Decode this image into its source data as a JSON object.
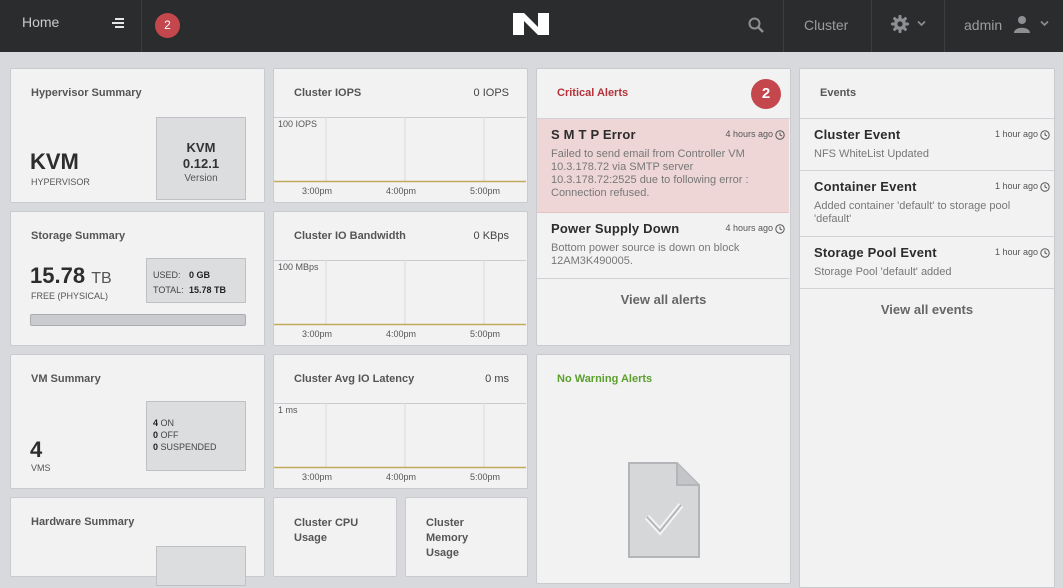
{
  "topbar": {
    "home_label": "Home",
    "alert_count": "2",
    "cluster_label": "Cluster",
    "user_label": "admin"
  },
  "colors": {
    "topbar_bg": "#2b2c2e",
    "badge_red": "#c4474d",
    "critical_bg": "#eed6d6",
    "no_warning_green": "#5b9f2d"
  },
  "hypervisor": {
    "title": "Hypervisor Summary",
    "name": "KVM",
    "sublabel": "HYPERVISOR",
    "box_name": "KVM",
    "box_version": "0.12.1",
    "box_label": "Version"
  },
  "storage": {
    "title": "Storage Summary",
    "value": "15.78",
    "unit": "TB",
    "sublabel": "FREE (PHYSICAL)",
    "used_label": "USED:",
    "used_value": "0 GB",
    "total_label": "TOTAL:",
    "total_value": "15.78 TB",
    "used_fraction": 0
  },
  "vm": {
    "title": "VM Summary",
    "count": "4",
    "sublabel": "VMS",
    "on_count": "4",
    "on_label": "ON",
    "off_count": "0",
    "off_label": "OFF",
    "suspended_count": "0",
    "suspended_label": "SUSPENDED"
  },
  "hardware": {
    "title": "Hardware Summary"
  },
  "iops": {
    "title": "Cluster IOPS",
    "value": "0 IOPS",
    "ymax": "100 IOPS",
    "x_ticks": [
      "3:00pm",
      "4:00pm",
      "5:00pm"
    ]
  },
  "bandwidth": {
    "title": "Cluster IO Bandwidth",
    "value": "0 KBps",
    "ymax": "100 MBps",
    "x_ticks": [
      "3:00pm",
      "4:00pm",
      "5:00pm"
    ]
  },
  "latency": {
    "title": "Cluster Avg IO Latency",
    "value": "0 ms",
    "ymax": "1 ms",
    "x_ticks": [
      "3:00pm",
      "4:00pm",
      "5:00pm"
    ]
  },
  "cpu": {
    "title_line1": "Cluster CPU",
    "title_line2": "Usage"
  },
  "memory": {
    "title_line1": "Cluster",
    "title_line2": "Memory",
    "title_line3": "Usage"
  },
  "critical_alerts": {
    "title": "Critical Alerts",
    "count": "2",
    "items": [
      {
        "title": "S M T P Error",
        "time": "4 hours ago",
        "desc_lines": [
          "Failed to send email from Controller VM",
          "10.3.178.72 via SMTP server",
          "10.3.178.72:2525 due to following error :",
          "Connection refused."
        ]
      },
      {
        "title": "Power Supply Down",
        "time": "4 hours ago",
        "desc_lines": [
          "Bottom power source is down on block",
          "12AM3K490005."
        ]
      }
    ],
    "view_all": "View all alerts"
  },
  "warning_alerts": {
    "title": "No Warning Alerts"
  },
  "events": {
    "title": "Events",
    "items": [
      {
        "title": "Cluster Event",
        "time": "1 hour ago",
        "desc_lines": [
          "NFS WhiteList Updated"
        ]
      },
      {
        "title": "Container Event",
        "time": "1 hour ago",
        "desc_lines": [
          "Added container 'default' to storage pool",
          "'default'"
        ]
      },
      {
        "title": "Storage Pool Event",
        "time": "1 hour ago",
        "desc_lines": [
          "Storage Pool 'default' added"
        ]
      }
    ],
    "view_all": "View all events"
  }
}
